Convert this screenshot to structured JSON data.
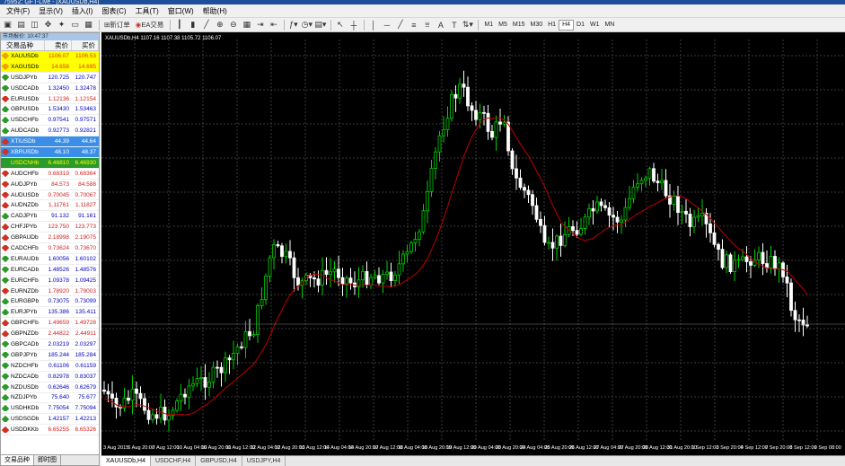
{
  "window": {
    "title": "75952: GFT-Live - [XAUUSDb,H4]"
  },
  "menu": [
    "文件(F)",
    "显示(V)",
    "插入(I)",
    "图表(C)",
    "工具(T)",
    "窗口(W)",
    "帮助(H)"
  ],
  "toolbar": {
    "new_order": "新订单",
    "ea_trading": "EA交易",
    "timeframes": [
      "M1",
      "M5",
      "M15",
      "M30",
      "H1",
      "H4",
      "D1",
      "W1",
      "MN"
    ],
    "active_timeframe": "H4"
  },
  "market_watch": {
    "title": "市场报价: 10:47:37",
    "headers": {
      "symbol": "交易品种",
      "bid": "卖价",
      "ask": "买价"
    },
    "rows": [
      {
        "symbol": "XAUUSDb",
        "bid": "1106.07",
        "ask": "1106.53",
        "dot": "#f0a000",
        "row_bg": "#ffff00",
        "text": "#d04000",
        "selected": false
      },
      {
        "symbol": "XAGUSDb",
        "bid": "14.656",
        "ask": "14.695",
        "dot": "#f0a000",
        "row_bg": "#ffff00",
        "text": "#d04000",
        "selected": false
      },
      {
        "symbol": "USDJPYb",
        "bid": "120.725",
        "ask": "120.747",
        "dot": "#2a9a2a",
        "row_bg": "#ffffff",
        "text": "#0000c0",
        "selected": false
      },
      {
        "symbol": "USDCADb",
        "bid": "1.32450",
        "ask": "1.32478",
        "dot": "#2a9a2a",
        "row_bg": "#ffffff",
        "text": "#0000c0",
        "selected": false
      },
      {
        "symbol": "EURUSDb",
        "bid": "1.12136",
        "ask": "1.12154",
        "dot": "#d03020",
        "row_bg": "#ffffff",
        "text": "#d02020",
        "selected": false
      },
      {
        "symbol": "GBPUSDb",
        "bid": "1.53430",
        "ask": "1.53463",
        "dot": "#2a9a2a",
        "row_bg": "#ffffff",
        "text": "#0000c0",
        "selected": false
      },
      {
        "symbol": "USDCHFb",
        "bid": "0.97541",
        "ask": "0.97571",
        "dot": "#2a9a2a",
        "row_bg": "#ffffff",
        "text": "#0000c0",
        "selected": false
      },
      {
        "symbol": "AUDCADb",
        "bid": "0.92773",
        "ask": "0.92821",
        "dot": "#2a9a2a",
        "row_bg": "#ffffff",
        "text": "#0000c0",
        "selected": false
      },
      {
        "symbol": "XTIUSDb",
        "bid": "44.39",
        "ask": "44.64",
        "dot": "#d03020",
        "row_bg": "#3a8ee8",
        "text": "#ffffff",
        "selected": true
      },
      {
        "symbol": "XBRUSDb",
        "bid": "48.10",
        "ask": "48.37",
        "dot": "#d03020",
        "row_bg": "#3a8ee8",
        "text": "#ffffff",
        "selected": true
      },
      {
        "symbol": "USDCNHb",
        "bid": "6.46810",
        "ask": "6.46930",
        "dot": "#2a9a2a",
        "row_bg": "#2a9a2a",
        "text": "#ffff00",
        "selected": true
      },
      {
        "symbol": "AUDCHFb",
        "bid": "0.68319",
        "ask": "0.68364",
        "dot": "#d03020",
        "row_bg": "#ffffff",
        "text": "#d02020",
        "selected": false
      },
      {
        "symbol": "AUDJPYb",
        "bid": "84.573",
        "ask": "84.588",
        "dot": "#d03020",
        "row_bg": "#ffffff",
        "text": "#d02020",
        "selected": false
      },
      {
        "symbol": "AUDUSDb",
        "bid": "0.70045",
        "ask": "0.70067",
        "dot": "#d03020",
        "row_bg": "#ffffff",
        "text": "#d02020",
        "selected": false
      },
      {
        "symbol": "AUDNZDb",
        "bid": "1.11761",
        "ask": "1.11827",
        "dot": "#d03020",
        "row_bg": "#ffffff",
        "text": "#d02020",
        "selected": false
      },
      {
        "symbol": "CADJPYb",
        "bid": "91.132",
        "ask": "91.161",
        "dot": "#2a9a2a",
        "row_bg": "#ffffff",
        "text": "#0000c0",
        "selected": false
      },
      {
        "symbol": "CHFJPYb",
        "bid": "123.750",
        "ask": "123.773",
        "dot": "#d03020",
        "row_bg": "#ffffff",
        "text": "#d02020",
        "selected": false
      },
      {
        "symbol": "GBPAUDb",
        "bid": "2.18998",
        "ask": "2.19075",
        "dot": "#d03020",
        "row_bg": "#ffffff",
        "text": "#d02020",
        "selected": false
      },
      {
        "symbol": "CADCHFb",
        "bid": "0.73624",
        "ask": "0.73670",
        "dot": "#d03020",
        "row_bg": "#ffffff",
        "text": "#d02020",
        "selected": false
      },
      {
        "symbol": "EURAUDb",
        "bid": "1.60056",
        "ask": "1.60102",
        "dot": "#2a9a2a",
        "row_bg": "#ffffff",
        "text": "#0000c0",
        "selected": false
      },
      {
        "symbol": "EURCADb",
        "bid": "1.48526",
        "ask": "1.48576",
        "dot": "#2a9a2a",
        "row_bg": "#ffffff",
        "text": "#0000c0",
        "selected": false
      },
      {
        "symbol": "EURCHFb",
        "bid": "1.09378",
        "ask": "1.09425",
        "dot": "#2a9a2a",
        "row_bg": "#ffffff",
        "text": "#0000c0",
        "selected": false
      },
      {
        "symbol": "EURNZDb",
        "bid": "1.78920",
        "ask": "1.79003",
        "dot": "#d03020",
        "row_bg": "#ffffff",
        "text": "#d02020",
        "selected": false
      },
      {
        "symbol": "EURGBPb",
        "bid": "0.73075",
        "ask": "0.73099",
        "dot": "#2a9a2a",
        "row_bg": "#ffffff",
        "text": "#0000c0",
        "selected": false
      },
      {
        "symbol": "EURJPYb",
        "bid": "135.386",
        "ask": "135.411",
        "dot": "#2a9a2a",
        "row_bg": "#ffffff",
        "text": "#0000c0",
        "selected": false
      },
      {
        "symbol": "GBPCHFb",
        "bid": "1.49659",
        "ask": "1.49728",
        "dot": "#d03020",
        "row_bg": "#ffffff",
        "text": "#d02020",
        "selected": false
      },
      {
        "symbol": "GBPNZDb",
        "bid": "2.44822",
        "ask": "2.44911",
        "dot": "#d03020",
        "row_bg": "#ffffff",
        "text": "#d02020",
        "selected": false
      },
      {
        "symbol": "GBPCADb",
        "bid": "2.03219",
        "ask": "2.03297",
        "dot": "#2a9a2a",
        "row_bg": "#ffffff",
        "text": "#0000c0",
        "selected": false
      },
      {
        "symbol": "GBPJPYb",
        "bid": "185.244",
        "ask": "185.284",
        "dot": "#2a9a2a",
        "row_bg": "#ffffff",
        "text": "#0000c0",
        "selected": false
      },
      {
        "symbol": "NZDCHFb",
        "bid": "0.61106",
        "ask": "0.61159",
        "dot": "#2a9a2a",
        "row_bg": "#ffffff",
        "text": "#0000c0",
        "selected": false
      },
      {
        "symbol": "NZDCADb",
        "bid": "0.82978",
        "ask": "0.83037",
        "dot": "#2a9a2a",
        "row_bg": "#ffffff",
        "text": "#0000c0",
        "selected": false
      },
      {
        "symbol": "NZDUSDb",
        "bid": "0.62646",
        "ask": "0.62679",
        "dot": "#2a9a2a",
        "row_bg": "#ffffff",
        "text": "#0000c0",
        "selected": false
      },
      {
        "symbol": "NZDJPYb",
        "bid": "75.640",
        "ask": "75.677",
        "dot": "#2a9a2a",
        "row_bg": "#ffffff",
        "text": "#0000c0",
        "selected": false
      },
      {
        "symbol": "USDHKDb",
        "bid": "7.75054",
        "ask": "7.75094",
        "dot": "#2a9a2a",
        "row_bg": "#ffffff",
        "text": "#0000c0",
        "selected": false
      },
      {
        "symbol": "USDSGDb",
        "bid": "1.42157",
        "ask": "1.42213",
        "dot": "#2a9a2a",
        "row_bg": "#ffffff",
        "text": "#0000c0",
        "selected": false
      },
      {
        "symbol": "USDDKKb",
        "bid": "6.65255",
        "ask": "6.65326",
        "dot": "#d03020",
        "row_bg": "#ffffff",
        "text": "#d02020",
        "selected": false
      }
    ],
    "tabs": [
      "交易品种",
      "即时图"
    ]
  },
  "chart": {
    "info": "XAUUSDb,H4  1107.16 1107.38 1105.72 1106.07",
    "bg": "#000000",
    "grid_color": "#3a3a3a",
    "up_color": "#00d000",
    "down_color": "#ffffff",
    "ma_color": "#c00000",
    "x_labels": [
      "3 Aug 2015",
      "6 Aug 20:00",
      "7 Aug 12:00",
      "10 Aug 04:00",
      "10 Aug 20:00",
      "11 Aug 12:00",
      "12 Aug 04:00",
      "12 Aug 20:00",
      "13 Aug 12:00",
      "14 Aug 04:00",
      "14 Aug 20:00",
      "17 Aug 12:00",
      "18 Aug 04:00",
      "18 Aug 20:00",
      "19 Aug 12:00",
      "20 Aug 04:00",
      "20 Aug 20:00",
      "24 Aug 04:00",
      "25 Aug 20:00",
      "26 Aug 12:00",
      "27 Aug 04:00",
      "27 Aug 20:00",
      "28 Aug 12:00",
      "31 Aug 20:00",
      "1 Sep 12:00",
      "3 Sep 20:00",
      "4 Sep 12:00",
      "7 Sep 20:00",
      "8 Sep 12:00",
      "9 Sep 08:00"
    ],
    "tabs": [
      "XAUUSDb,H4",
      "USDCHF,H4",
      "GBPUSD,H4",
      "USDJPY,H4"
    ],
    "active_tab": "XAUUSDb,H4"
  }
}
